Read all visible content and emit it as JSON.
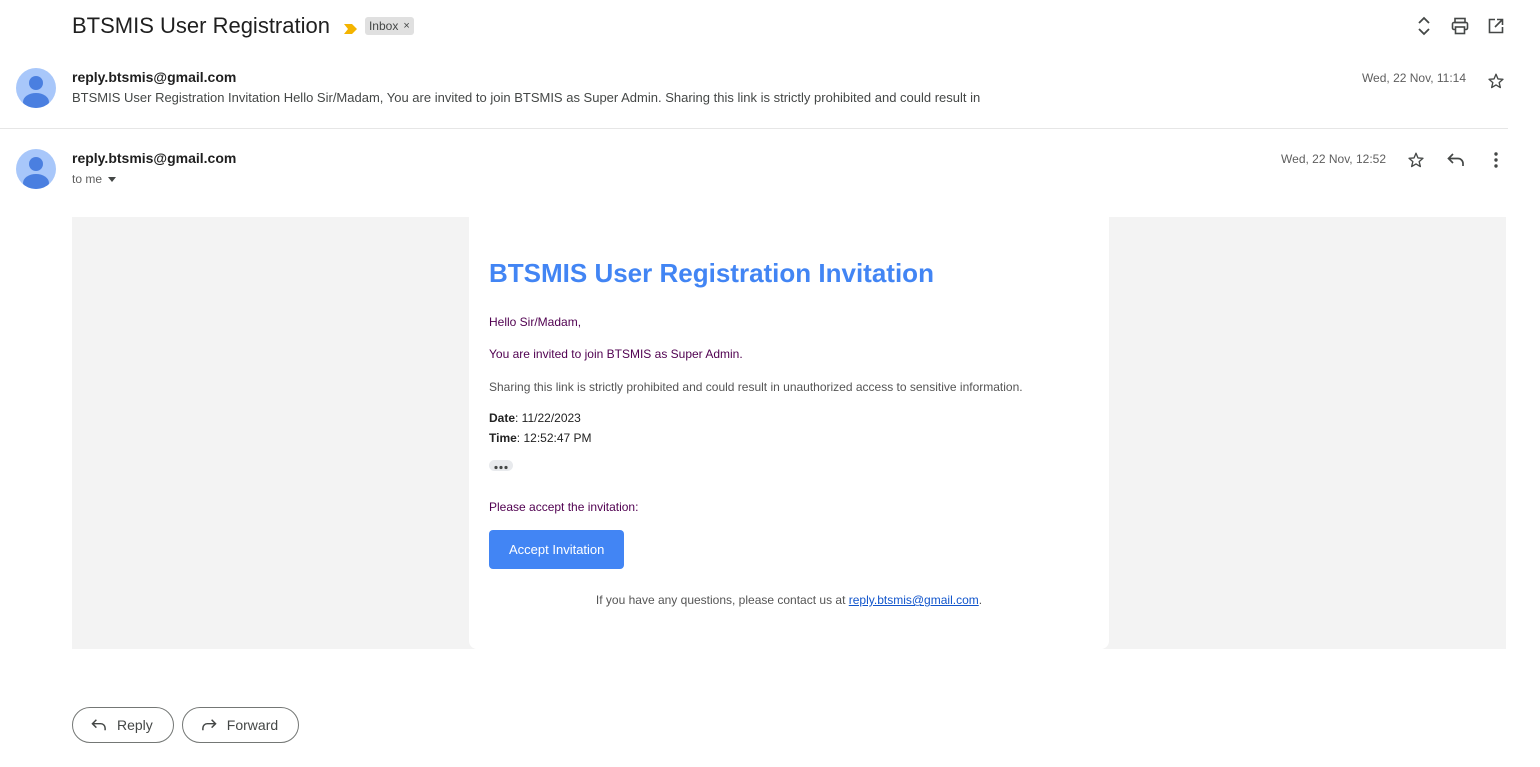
{
  "thread": {
    "subject": "BTSMIS User Registration",
    "label_chip": "Inbox",
    "label_chip_close": "×"
  },
  "message1": {
    "sender": "reply.btsmis@gmail.com",
    "snippet": "BTSMIS User Registration Invitation Hello Sir/Madam, You are invited to join BTSMIS as Super Admin. Sharing this link is strictly prohibited and could result in",
    "date": "Wed, 22 Nov, 11:14"
  },
  "message2": {
    "sender": "reply.btsmis@gmail.com",
    "to": "to me",
    "date": "Wed, 22 Nov, 12:52"
  },
  "email": {
    "title": "BTSMIS User Registration Invitation",
    "greeting": "Hello Sir/Madam,",
    "invite_line": "You are invited to join BTSMIS as Super Admin.",
    "warning": "Sharing this link is strictly prohibited and could result in unauthorized access to sensitive information.",
    "date_label": "Date",
    "date_value": ": 11/22/2023",
    "time_label": "Time",
    "time_value": ": 12:52:47 PM",
    "accept_prompt": "Please accept the invitation:",
    "accept_button": "Accept Invitation",
    "contact_prefix": "If you have any questions, please contact us at ",
    "contact_email": "reply.btsmis@gmail.com",
    "contact_suffix": "."
  },
  "actions": {
    "reply": "Reply",
    "forward": "Forward"
  },
  "colors": {
    "accent": "#4285f4",
    "purple_text": "#500050",
    "avatar_bg": "#a8c7fa",
    "avatar_fg": "#4a7fe0"
  }
}
